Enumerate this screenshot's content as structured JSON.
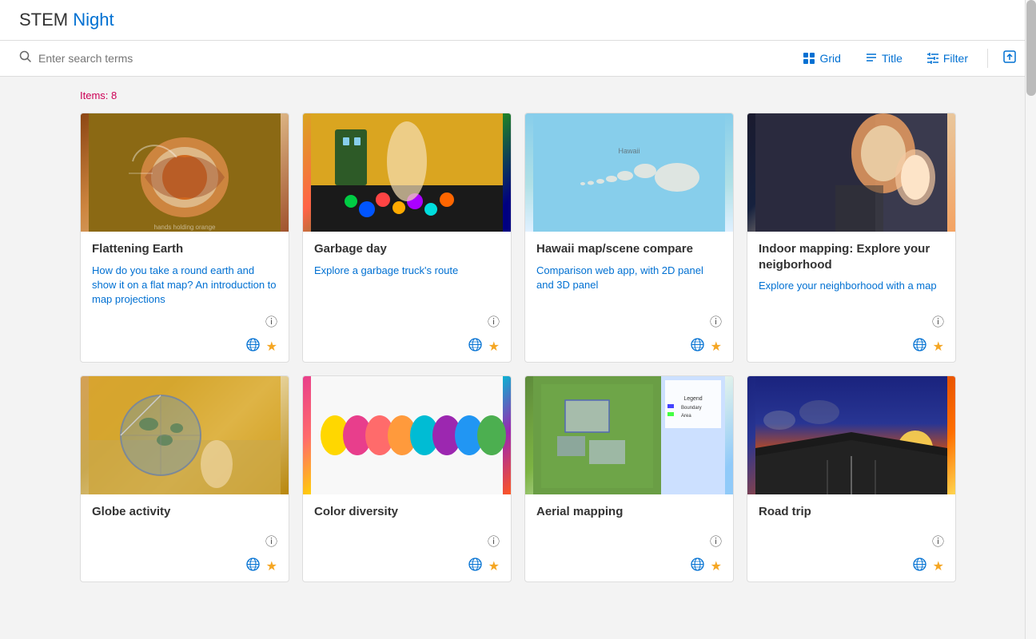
{
  "header": {
    "title_stem": "STEM",
    "title_night": " Night"
  },
  "toolbar": {
    "search_placeholder": "Enter search terms",
    "grid_label": "Grid",
    "title_label": "Title",
    "filter_label": "Filter"
  },
  "content": {
    "items_label": "Items: 8",
    "cards": [
      {
        "id": 1,
        "title": "Flattening Earth",
        "description": "How do you take a round earth and show it on a flat map? An introduction to map projections",
        "thumb_class": "thumb-1"
      },
      {
        "id": 2,
        "title": "Garbage day",
        "description": "Explore a garbage truck's route",
        "thumb_class": "thumb-2"
      },
      {
        "id": 3,
        "title": "Hawaii map/scene compare",
        "description": "Comparison web app, with 2D panel and 3D panel",
        "thumb_class": "thumb-3"
      },
      {
        "id": 4,
        "title": "Indoor mapping: Explore your neigborhood",
        "description": "Explore your neighborhood with a map",
        "thumb_class": "thumb-4"
      },
      {
        "id": 5,
        "title": "Globe activity",
        "description": "",
        "thumb_class": "thumb-5"
      },
      {
        "id": 6,
        "title": "Color diversity",
        "description": "",
        "thumb_class": "thumb-6"
      },
      {
        "id": 7,
        "title": "Aerial mapping",
        "description": "",
        "thumb_class": "thumb-7"
      },
      {
        "id": 8,
        "title": "Road trip",
        "description": "",
        "thumb_class": "thumb-8"
      }
    ]
  }
}
